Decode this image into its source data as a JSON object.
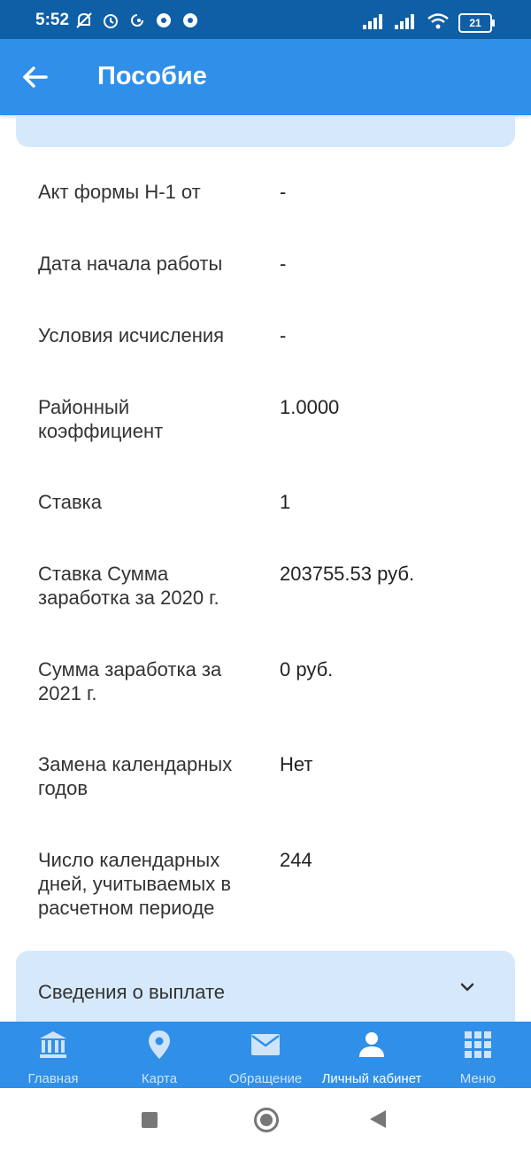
{
  "status_bar": {
    "time": "5:52",
    "battery": "21"
  },
  "app_bar": {
    "title": "Пособие"
  },
  "details": [
    {
      "label": "Акт формы Н-1 от",
      "value": "-"
    },
    {
      "label": "Дата начала работы",
      "value": "-"
    },
    {
      "label": "Условия исчисления",
      "value": "-"
    },
    {
      "label": "Районный коэффициент",
      "value": "1.0000"
    },
    {
      "label": "Ставка",
      "value": "1"
    },
    {
      "label": "Ставка Сумма заработка за 2020 г.",
      "value": "203755.53 руб."
    },
    {
      "label": "Сумма заработка за 2021 г.",
      "value": "0 руб."
    },
    {
      "label": "Замена календарных годов",
      "value": "Нет"
    },
    {
      "label": "Число календарных дней, учитываемых в расчетном периоде",
      "value": "244"
    }
  ],
  "payment_section": {
    "label": "Сведения о выплате"
  },
  "bottom_nav": [
    {
      "label": "Главная",
      "icon": "bank-icon"
    },
    {
      "label": "Карта",
      "icon": "map-pin-icon"
    },
    {
      "label": "Обращение",
      "icon": "mail-icon"
    },
    {
      "label": "Личный кабинет",
      "icon": "person-icon"
    },
    {
      "label": "Меню",
      "icon": "grid-icon"
    }
  ],
  "colors": {
    "app_bar": "#2f8fe9",
    "status_bar": "#0f5fa6",
    "card": "#d6e9fb"
  }
}
